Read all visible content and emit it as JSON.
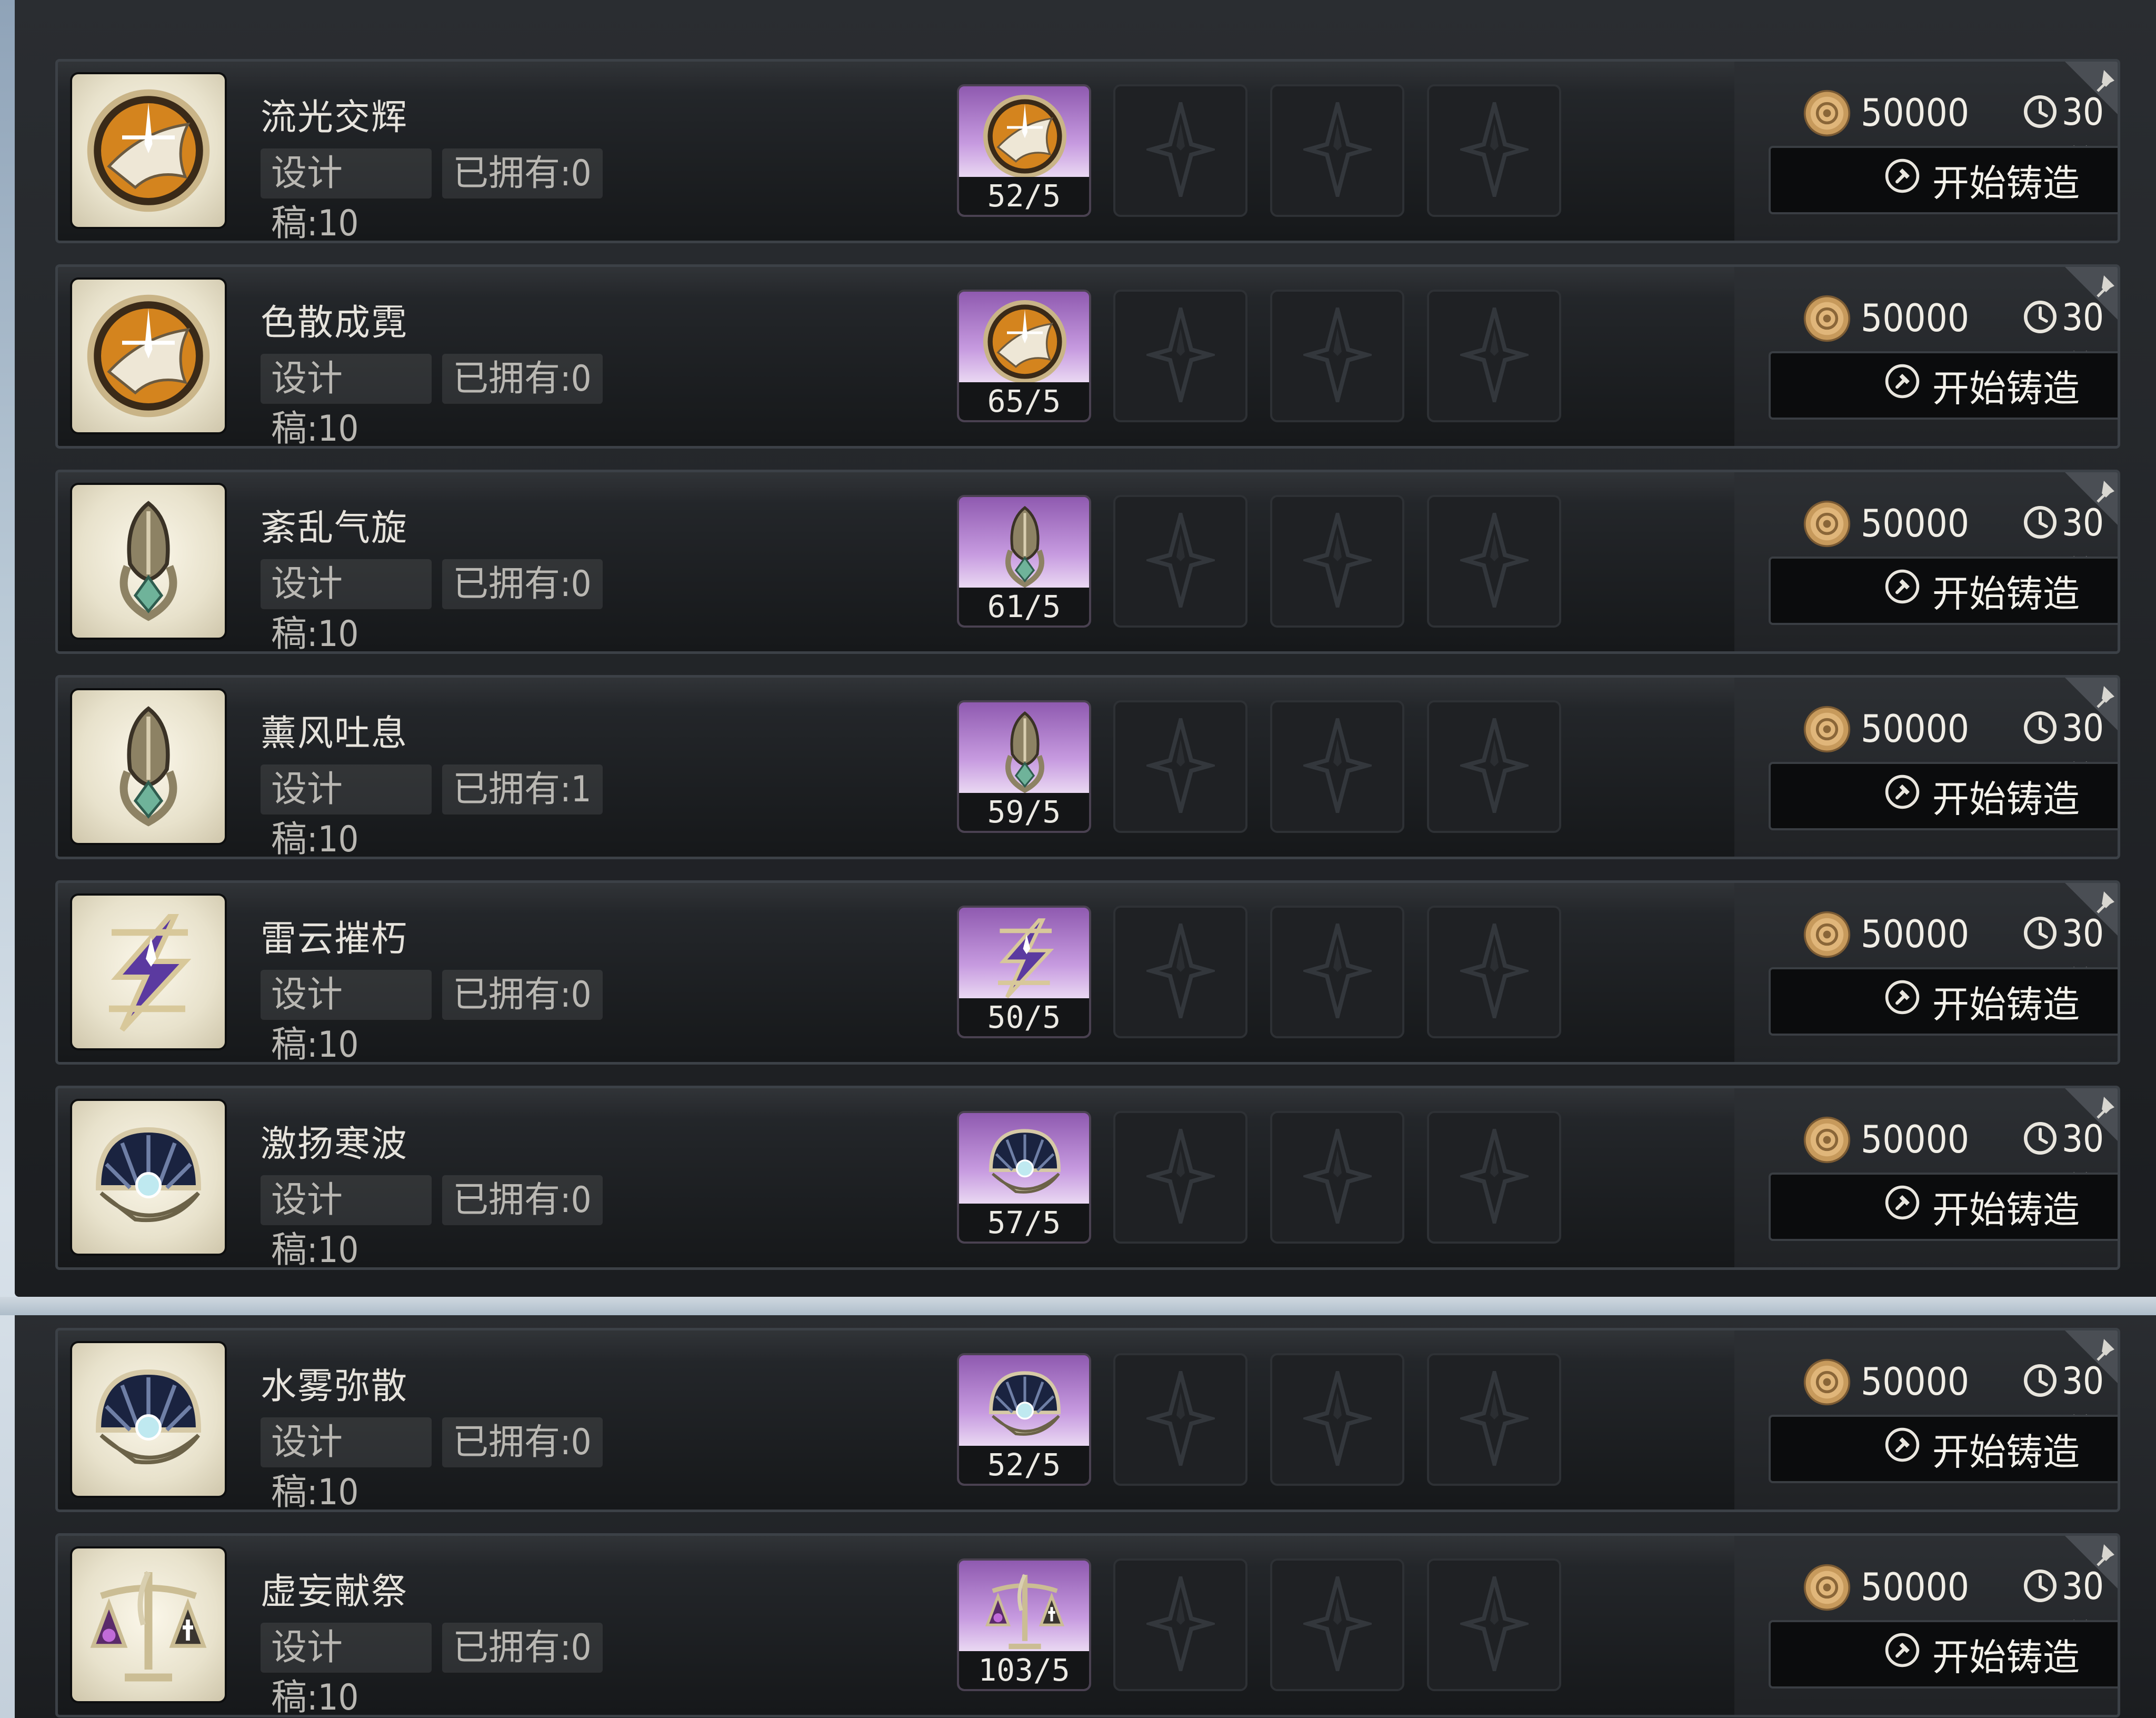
{
  "currency_icon": "coin-icon",
  "time_icon": "clock-icon",
  "button_icon": "hammer-badge-icon",
  "rows": [
    {
      "name": "流光交辉",
      "design": "设计稿:10",
      "owned": "已拥有:0",
      "material_count": "52/5",
      "cost": "50000",
      "time": "30分",
      "button": "开始铸造",
      "icon": "winged-medallion-icon"
    },
    {
      "name": "色散成霓",
      "design": "设计稿:10",
      "owned": "已拥有:0",
      "material_count": "65/5",
      "cost": "50000",
      "time": "30分",
      "button": "开始铸造",
      "icon": "winged-medallion-icon"
    },
    {
      "name": "紊乱气旋",
      "design": "设计稿:10",
      "owned": "已拥有:0",
      "material_count": "61/5",
      "cost": "50000",
      "time": "30分",
      "button": "开始铸造",
      "icon": "leaf-pendant-icon"
    },
    {
      "name": "薰风吐息",
      "design": "设计稿:10",
      "owned": "已拥有:1",
      "material_count": "59/5",
      "cost": "50000",
      "time": "30分",
      "button": "开始铸造",
      "icon": "leaf-pendant-icon"
    },
    {
      "name": "雷云摧朽",
      "design": "设计稿:10",
      "owned": "已拥有:0",
      "material_count": "50/5",
      "cost": "50000",
      "time": "30分",
      "button": "开始铸造",
      "icon": "lightning-bolt-icon"
    },
    {
      "name": "激扬寒波",
      "design": "设计稿:10",
      "owned": "已拥有:0",
      "material_count": "57/5",
      "cost": "50000",
      "time": "30分",
      "button": "开始铸造",
      "icon": "shell-pearl-icon"
    },
    {
      "name": "水雾弥散",
      "design": "设计稿:10",
      "owned": "已拥有:0",
      "material_count": "52/5",
      "cost": "50000",
      "time": "30分",
      "button": "开始铸造",
      "icon": "shell-pearl-icon"
    },
    {
      "name": "虚妄献祭",
      "design": "设计稿:10",
      "owned": "已拥有:0",
      "material_count": "103/5",
      "cost": "50000",
      "time": "30分",
      "button": "开始铸造",
      "icon": "scales-icon"
    }
  ]
}
